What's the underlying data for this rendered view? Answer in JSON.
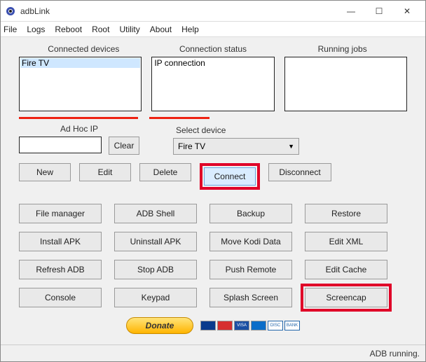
{
  "window": {
    "title": "adbLink"
  },
  "win_btns": {
    "min": "—",
    "max": "☐",
    "close": "✕"
  },
  "menu": {
    "file": "File",
    "logs": "Logs",
    "reboot": "Reboot",
    "root": "Root",
    "utility": "Utility",
    "about": "About",
    "help": "Help"
  },
  "top": {
    "connected_label": "Connected devices",
    "status_label": "Connection status",
    "jobs_label": "Running jobs",
    "connected_item": "Fire TV",
    "status_item": "IP connection"
  },
  "adhoc": {
    "label": "Ad Hoc IP",
    "value": ""
  },
  "clear_btn": "Clear",
  "select": {
    "label": "Select device",
    "value": "Fire TV"
  },
  "row3": {
    "new": "New",
    "edit": "Edit",
    "delete": "Delete",
    "connect": "Connect",
    "disconnect": "Disconnect"
  },
  "grid": {
    "file_manager": "File manager",
    "adb_shell": "ADB Shell",
    "backup": "Backup",
    "restore": "Restore",
    "install_apk": "Install APK",
    "uninstall_apk": "Uninstall APK",
    "move_kodi": "Move Kodi Data",
    "edit_xml": "Edit XML",
    "refresh_adb": "Refresh ADB",
    "stop_adb": "Stop ADB",
    "push_remote": "Push Remote",
    "edit_cache": "Edit Cache",
    "console": "Console",
    "keypad": "Keypad",
    "splash": "Splash Screen",
    "screencap": "Screencap"
  },
  "donate": "Donate",
  "status": "ADB running."
}
